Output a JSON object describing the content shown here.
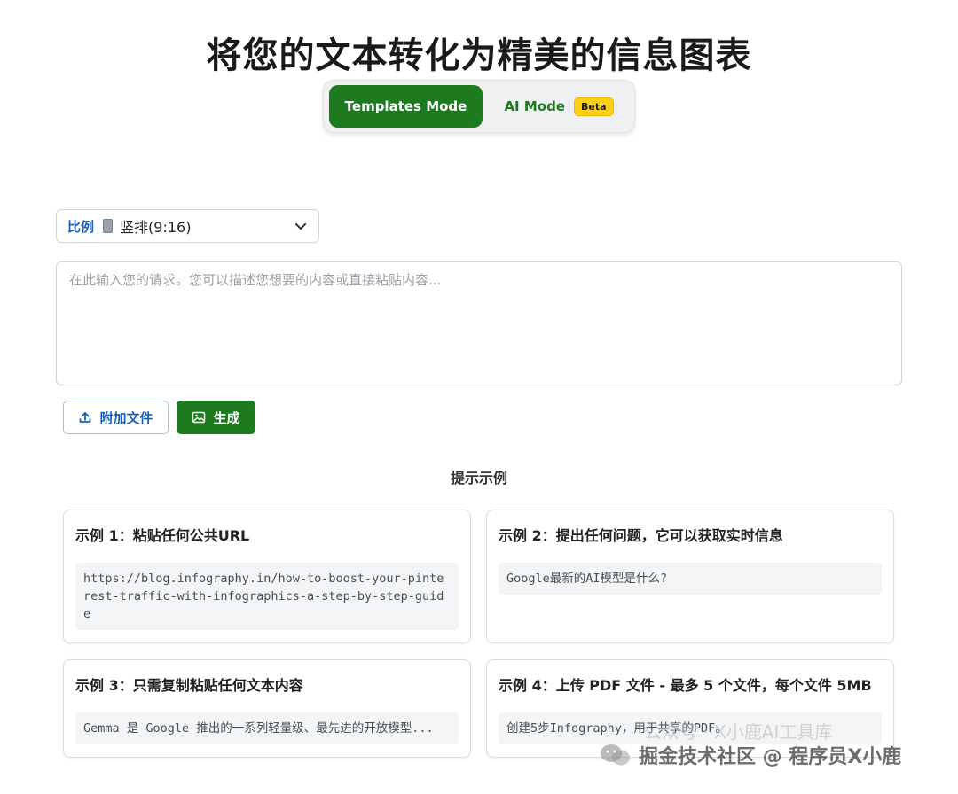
{
  "page": {
    "title": "将您的文本转化为精美的信息图表"
  },
  "mode_toggle": {
    "templates_label": "Templates Mode",
    "ai_label": "AI Mode",
    "beta_badge": "Beta"
  },
  "ratio": {
    "label": "比例",
    "value": "竖排(9:16)"
  },
  "prompt": {
    "placeholder": "在此输入您的请求。您可以描述您想要的内容或直接粘贴内容...",
    "value": ""
  },
  "actions": {
    "attach_label": "附加文件",
    "generate_label": "生成"
  },
  "examples": {
    "heading": "提示示例",
    "items": [
      {
        "title": "示例 1：粘贴任何公共URL",
        "content": "https://blog.infography.in/how-to-boost-your-pinterest-traffic-with-infographics-a-step-by-step-guide"
      },
      {
        "title": "示例 2：提出任何问题，它可以获取实时信息",
        "content": "Google最新的AI模型是什么?"
      },
      {
        "title": "示例 3：只需复制粘贴任何文本内容",
        "content": "Gemma 是 Google 推出的一系列轻量级、最先进的开放模型..."
      },
      {
        "title": "示例 4：上传 PDF 文件 - 最多 5 个文件，每个文件 5MB",
        "content": "创建5步Infography，用于共享的PDF。"
      }
    ]
  },
  "watermark": {
    "text": "掘金技术社区 @ 程序员X小鹿",
    "sub_text": "公众号 · X小鹿AI工具库"
  },
  "colors": {
    "primary_green": "#1d7a1f",
    "link_blue": "#1a5fb4",
    "beta_yellow": "#fcd116"
  }
}
